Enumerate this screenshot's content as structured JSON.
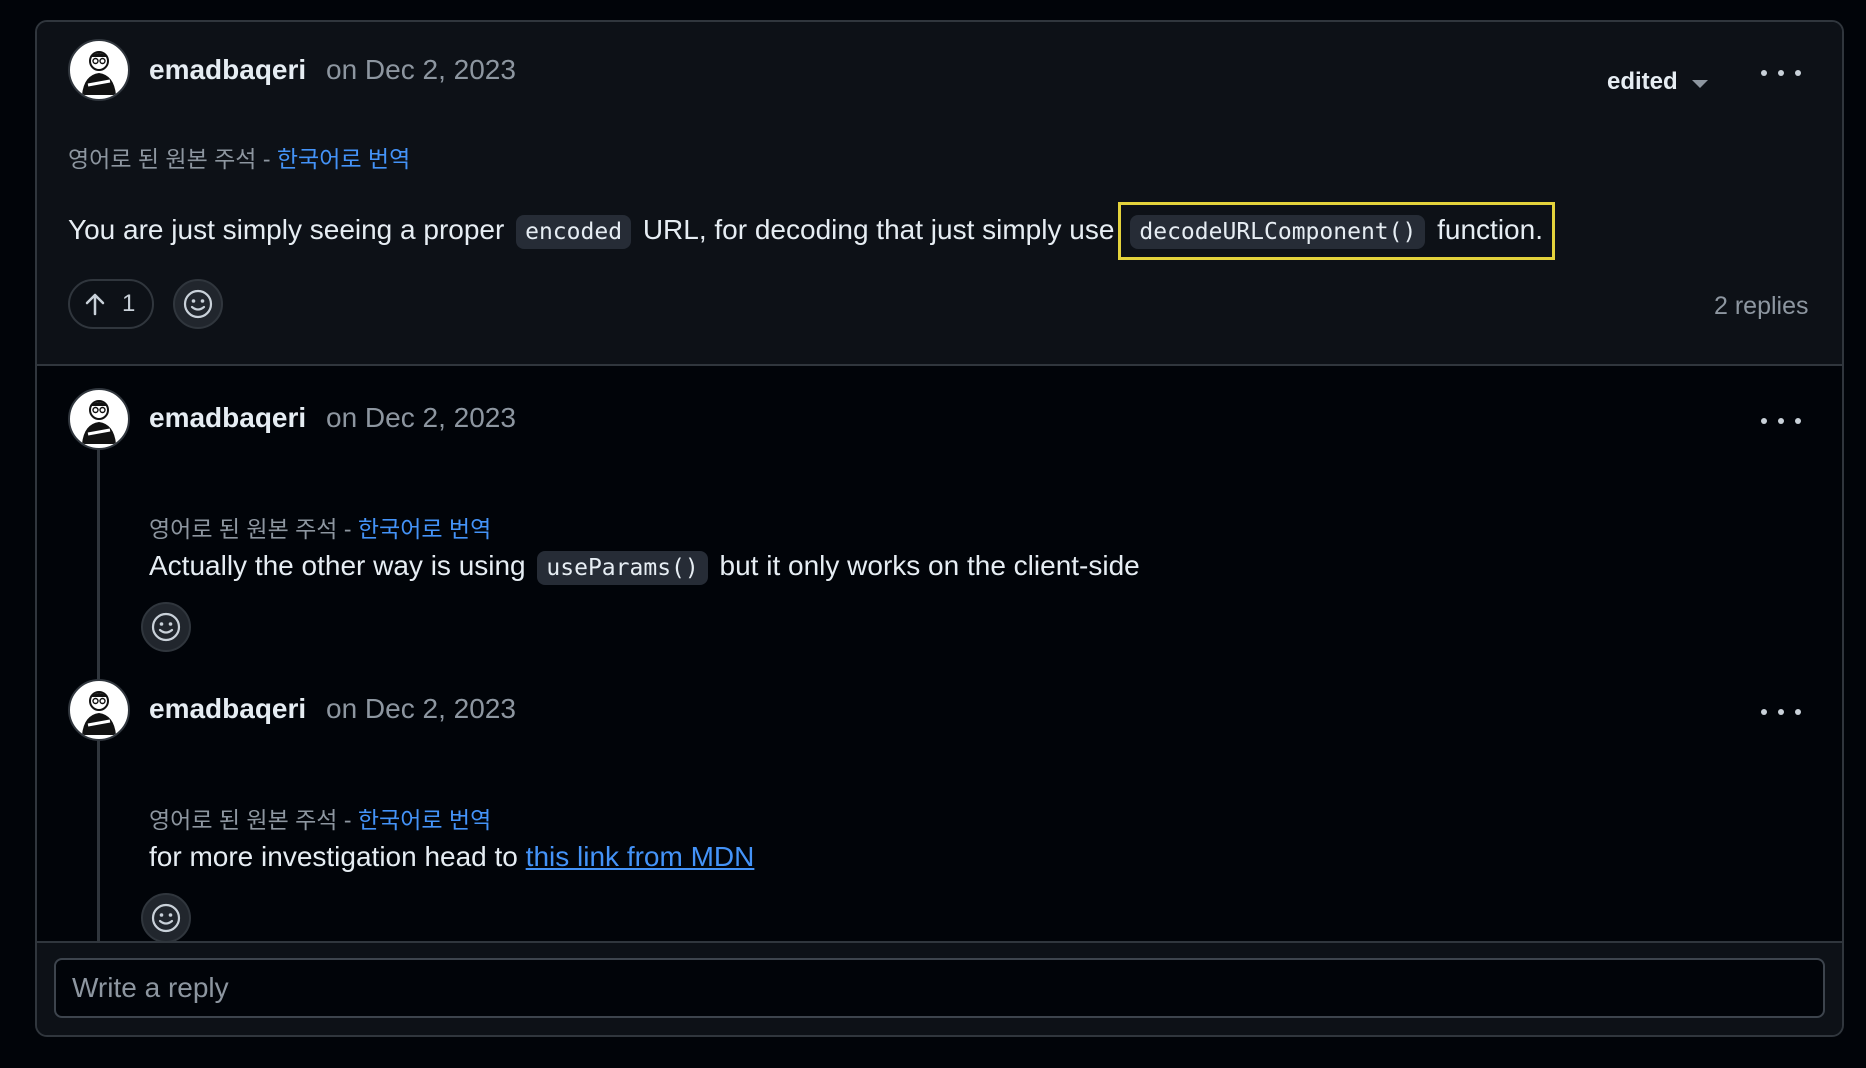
{
  "comment": {
    "author": "emadbaqeri",
    "date": "on Dec 2, 2023",
    "edited_label": "edited",
    "translate_prefix": "영어로 된 원본 주석 - ",
    "translate_link": "한국어로 번역",
    "body_before": "You are just simply seeing a proper",
    "code_1": "encoded",
    "body_middle": "URL, for decoding that just simply use",
    "code_2": "decodeURLComponent()",
    "body_after": "function.",
    "upvote_count": "1",
    "replies_count": "2 replies",
    "highlight_color": "#e3d23c"
  },
  "replies": [
    {
      "author": "emadbaqeri",
      "date": "on Dec 2, 2023",
      "translate_prefix": "영어로 된 원본 주석 - ",
      "translate_link": "한국어로 번역",
      "body_before": "Actually the other way is using",
      "code": "useParams()",
      "body_after": "but it only works on the client-side"
    },
    {
      "author": "emadbaqeri",
      "date": "on Dec 2, 2023",
      "translate_prefix": "영어로 된 원본 주석 - ",
      "translate_link": "한국어로 번역",
      "body_before": "for more investigation head to",
      "link_text": "this link from MDN"
    }
  ],
  "reply_box": {
    "placeholder": "Write a reply"
  },
  "icons": {
    "upvote": "arrow-up-icon",
    "reaction": "smiley-icon",
    "more": "kebab-horizontal-icon",
    "dropdown": "triangle-down-icon"
  },
  "colors": {
    "link": "#4493f8",
    "muted": "#8d96a0",
    "border": "#30363d"
  }
}
